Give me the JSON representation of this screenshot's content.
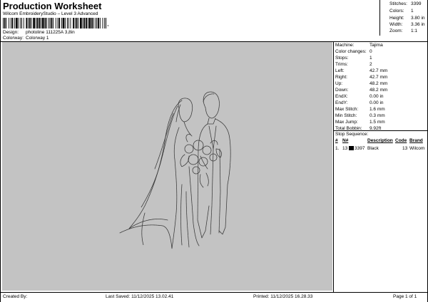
{
  "header": {
    "title": "Production Worksheet",
    "subtitle": "Wilcom EmbroideryStudio – Level 3 Advanced",
    "barcode_suffix": ",",
    "design_label": "Design:",
    "design_value": "photoline 111225A 3,8in",
    "colorway_label": "Colorway:",
    "colorway_value": "Colorway 1"
  },
  "stats": [
    {
      "label": "Stitches:",
      "value": "3399"
    },
    {
      "label": "Colors:",
      "value": "1"
    },
    {
      "label": "Height:",
      "value": "3.80 in"
    },
    {
      "label": "Width:",
      "value": "3.36 in"
    },
    {
      "label": "Zoom:",
      "value": "1:1"
    }
  ],
  "machine_info": [
    {
      "label": "Machine:",
      "value": "Tajima"
    },
    {
      "label": "Color changes:",
      "value": "0"
    },
    {
      "label": "Stops:",
      "value": "1"
    },
    {
      "label": "Trims:",
      "value": "2"
    },
    {
      "label": "Left:",
      "value": "42.7 mm"
    },
    {
      "label": "Right:",
      "value": "42.7 mm"
    },
    {
      "label": "Up:",
      "value": "48.2 mm"
    },
    {
      "label": "Down:",
      "value": "48.2 mm"
    },
    {
      "label": "EndX:",
      "value": "0.00 in"
    },
    {
      "label": "EndY:",
      "value": "0.00 in"
    },
    {
      "label": "Max Stitch:",
      "value": "1.6 mm"
    },
    {
      "label": "Min Stitch:",
      "value": "0.3 mm"
    },
    {
      "label": "Max Jump:",
      "value": "1.5 mm"
    },
    {
      "label": "Total Bobbin:",
      "value": "9.92ft"
    }
  ],
  "stop_sequence": {
    "title": "Stop Sequence:",
    "columns": [
      "#",
      "N#",
      "",
      "Description",
      "Code",
      "Brand"
    ],
    "rows": [
      {
        "num": "1.",
        "needle": "13",
        "color": "#000000",
        "stitches": "3397",
        "description": "Black",
        "code": "13",
        "brand": "Wilcom"
      }
    ]
  },
  "footer": {
    "created_by": "Created By:",
    "last_saved": "Last Saved: 11/12/2025 13.02.41",
    "printed": "Printed: 11/12/2025 16.28.33",
    "page": "Page 1 of 1"
  }
}
